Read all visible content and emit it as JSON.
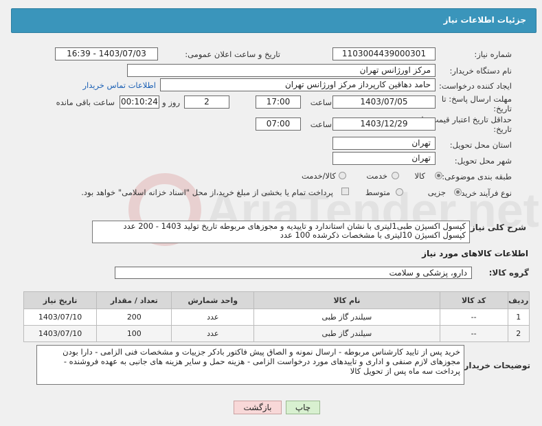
{
  "header": {
    "title": "جزئیات اطلاعات نیاز"
  },
  "form": {
    "need_number_label": "شماره نیاز:",
    "need_number": "1103004439000301",
    "announce_label": "تاریخ و ساعت اعلان عمومی:",
    "announce_value": "1403/07/03 - 16:39",
    "buyer_org_label": "نام دستگاه خریدار:",
    "buyer_org": "مرکز اورژانس تهران",
    "creator_label": "ایجاد کننده درخواست:",
    "creator": "حامد دهاقین کارپرداز مرکز اورژانس تهران",
    "contact_link": "اطلاعات تماس خریدار",
    "deadline_label_line1": "مهلت ارسال پاسخ: تا",
    "deadline_label_line2": "تاریخ:",
    "deadline_date": "1403/07/05",
    "time_label": "ساعت",
    "deadline_time": "17:00",
    "days_value": "2",
    "days_label": "روز و",
    "remaining_time": "00:10:24",
    "remaining_label": "ساعت باقی مانده",
    "validity_label_line1": "حداقل تاریخ اعتبار قیمت: تا",
    "validity_label_line2": "تاریخ:",
    "validity_date": "1403/12/29",
    "validity_time": "07:00",
    "province_label": "استان محل تحویل:",
    "province": "تهران",
    "city_label": "شهر محل تحویل:",
    "city": "تهران",
    "category_label": "طبقه بندی موضوعی:",
    "category_options": [
      "کالا",
      "خدمت",
      "کالا/خدمت"
    ],
    "purchase_type_label": "نوع فرآیند خرید :",
    "purchase_options": [
      "جزیی",
      "متوسط"
    ],
    "payment_note": "پرداخت تمام یا بخشی از مبلغ خرید،از محل \"اسناد خزانه اسلامی\" خواهد بود."
  },
  "summary": {
    "label": "شرح کلی نیاز:",
    "line1": "کپسول اکسیژن طبی1لیتری با نشان استاندارد و تاییدیه و مجوزهای مربوطه تاریخ تولید 1403 - 200 عدد",
    "line2": "کپسول اکسیژن 10لیتری با مشخصات ذکرشده 100 عدد"
  },
  "goods": {
    "section_title": "اطلاعات کالاهای مورد نیاز",
    "group_label": "گروه کالا:",
    "group_value": "دارو، پزشکی و سلامت",
    "columns": [
      "ردیف",
      "کد کالا",
      "نام کالا",
      "واحد شمارش",
      "تعداد / مقدار",
      "تاریخ نیاز"
    ],
    "rows": [
      [
        "1",
        "--",
        "سیلندر گاز طبی",
        "عدد",
        "200",
        "1403/07/10"
      ],
      [
        "2",
        "--",
        "سیلندر گاز طبی",
        "عدد",
        "100",
        "1403/07/10"
      ]
    ]
  },
  "buyer_notes": {
    "label": "توضیحات خریدار:",
    "line1": "خرید پس از تایید کارشناس مربوطه - ارسال نمونه و الصاق پیش فاکتور بادکر جزییات و مشخصات فنی الزامی - دارا بودن",
    "line2": "مجوزهای لازم صنفی و اداری و تاییدهای مورد درخواست الزامی - هزینه حمل و سایر هزینه های جانبی به عهده فروشنده -",
    "line3": "پرداخت سه ماه پس از تحویل کالا"
  },
  "buttons": {
    "print": "چاپ",
    "back": "بازگشت"
  },
  "watermark": "AriaTender.net"
}
